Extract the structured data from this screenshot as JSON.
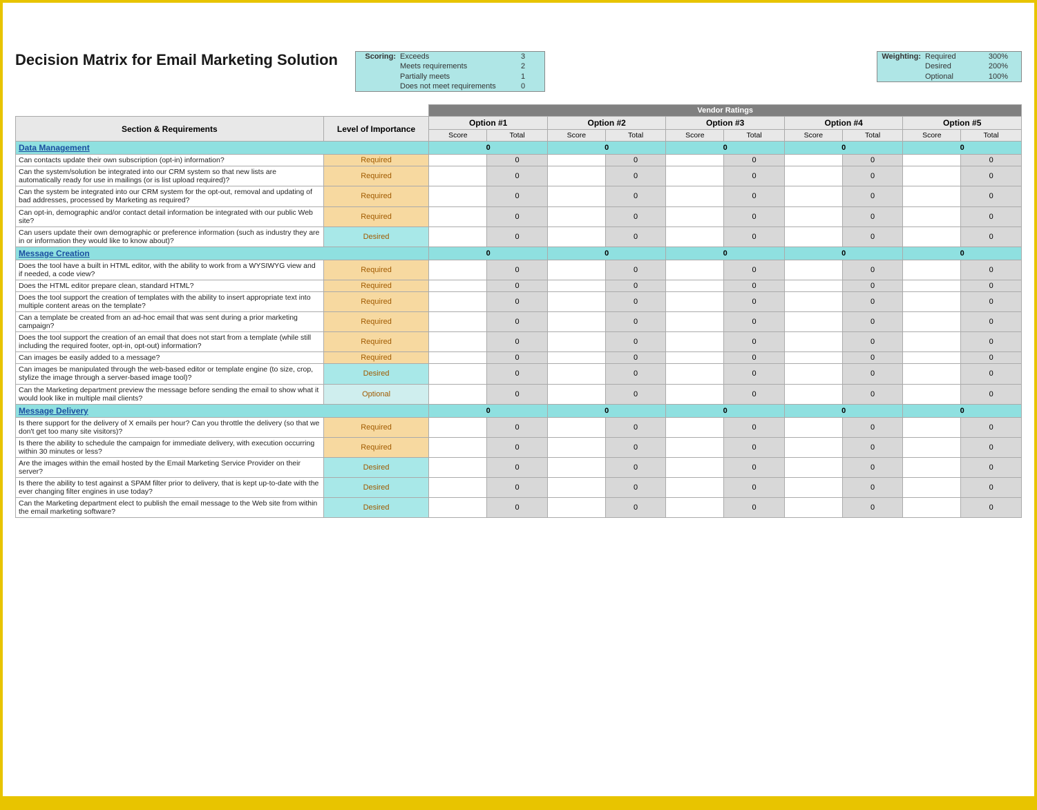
{
  "title": "Decision Matrix for Email Marketing Solution",
  "scoring": {
    "label": "Scoring:",
    "rows": [
      {
        "text": "Exceeds",
        "value": "3"
      },
      {
        "text": "Meets requirements",
        "value": "2"
      },
      {
        "text": "Partially meets",
        "value": "1"
      },
      {
        "text": "Does not meet requirements",
        "value": "0"
      }
    ]
  },
  "weighting": {
    "label": "Weighting:",
    "rows": [
      {
        "text": "Required",
        "value": "300%"
      },
      {
        "text": "Desired",
        "value": "200%"
      },
      {
        "text": "Optional",
        "value": "100%"
      }
    ]
  },
  "headers": {
    "vendor_ratings": "Vendor Ratings",
    "section_req": "Section & Requirements",
    "importance": "Level of Importance",
    "options": [
      "Option #1",
      "Option #2",
      "Option #3",
      "Option #4",
      "Option #5"
    ],
    "score": "Score",
    "total": "Total"
  },
  "sections": [
    {
      "name": "Data Management",
      "totals": [
        "0",
        "0",
        "0",
        "0",
        "0"
      ],
      "rows": [
        {
          "req": "Can contacts update their own subscription (opt-in) information?",
          "importance": "Required",
          "totals": [
            "0",
            "0",
            "0",
            "0",
            "0"
          ]
        },
        {
          "req": "Can the system/solution be integrated into our CRM system so that new lists are automatically ready for use in mailings (or is list upload required)?",
          "importance": "Required",
          "totals": [
            "0",
            "0",
            "0",
            "0",
            "0"
          ]
        },
        {
          "req": "Can the system be integrated into our CRM system for the opt-out, removal and updating of bad addresses, processed by Marketing as required?",
          "importance": "Required",
          "totals": [
            "0",
            "0",
            "0",
            "0",
            "0"
          ]
        },
        {
          "req": "Can opt-in, demographic and/or contact detail information be integrated with our public Web site?",
          "importance": "Required",
          "totals": [
            "0",
            "0",
            "0",
            "0",
            "0"
          ]
        },
        {
          "req": "Can users update their own demographic or preference information (such as industry they are in or information they would like to know about)?",
          "importance": "Desired",
          "totals": [
            "0",
            "0",
            "0",
            "0",
            "0"
          ]
        }
      ]
    },
    {
      "name": "Message Creation",
      "totals": [
        "0",
        "0",
        "0",
        "0",
        "0"
      ],
      "rows": [
        {
          "req": "Does the tool have a built in HTML editor, with the ability to work from a WYSIWYG view and if needed, a code view?",
          "importance": "Required",
          "totals": [
            "0",
            "0",
            "0",
            "0",
            "0"
          ]
        },
        {
          "req": "Does the HTML editor prepare clean, standard HTML?",
          "importance": "Required",
          "totals": [
            "0",
            "0",
            "0",
            "0",
            "0"
          ]
        },
        {
          "req": "Does the tool support the creation of templates with the ability to insert appropriate text into multiple content areas on the template?",
          "importance": "Required",
          "totals": [
            "0",
            "0",
            "0",
            "0",
            "0"
          ]
        },
        {
          "req": "Can a template be created from an ad-hoc email that was sent during a prior marketing campaign?",
          "importance": "Required",
          "totals": [
            "0",
            "0",
            "0",
            "0",
            "0"
          ]
        },
        {
          "req": "Does the tool support the creation of an email that does not start from a template (while still including the required footer, opt-in, opt-out) information?",
          "importance": "Required",
          "totals": [
            "0",
            "0",
            "0",
            "0",
            "0"
          ]
        },
        {
          "req": "Can images be easily added to a message?",
          "importance": "Required",
          "totals": [
            "0",
            "0",
            "0",
            "0",
            "0"
          ]
        },
        {
          "req": "Can images be manipulated through the web-based editor or template engine (to size, crop, stylize the image through a server-based image tool)?",
          "importance": "Desired",
          "totals": [
            "0",
            "0",
            "0",
            "0",
            "0"
          ]
        },
        {
          "req": "Can the Marketing department preview the message before sending the email to show what it would look like in multiple mail clients?",
          "importance": "Optional",
          "totals": [
            "0",
            "0",
            "0",
            "0",
            "0"
          ]
        }
      ]
    },
    {
      "name": "Message Delivery",
      "totals": [
        "0",
        "0",
        "0",
        "0",
        "0"
      ],
      "rows": [
        {
          "req": "Is there support for the delivery of X emails per hour?  Can you throttle the delivery (so that we don't get too many site visitors)?",
          "importance": "Required",
          "totals": [
            "0",
            "0",
            "0",
            "0",
            "0"
          ]
        },
        {
          "req": "Is there the ability to schedule the campaign for immediate delivery, with execution occurring within 30 minutes or less?",
          "importance": "Required",
          "totals": [
            "0",
            "0",
            "0",
            "0",
            "0"
          ]
        },
        {
          "req": "Are the images within the email hosted by the Email Marketing Service Provider on their server?",
          "importance": "Desired",
          "totals": [
            "0",
            "0",
            "0",
            "0",
            "0"
          ]
        },
        {
          "req": "Is there the ability to test against a SPAM filter prior to delivery, that is kept up-to-date with the ever changing filter engines in use today?",
          "importance": "Desired",
          "totals": [
            "0",
            "0",
            "0",
            "0",
            "0"
          ]
        },
        {
          "req": "Can the Marketing department elect to publish the email message to the Web site from within the email marketing software?",
          "importance": "Desired",
          "totals": [
            "0",
            "0",
            "0",
            "0",
            "0"
          ]
        }
      ]
    }
  ]
}
